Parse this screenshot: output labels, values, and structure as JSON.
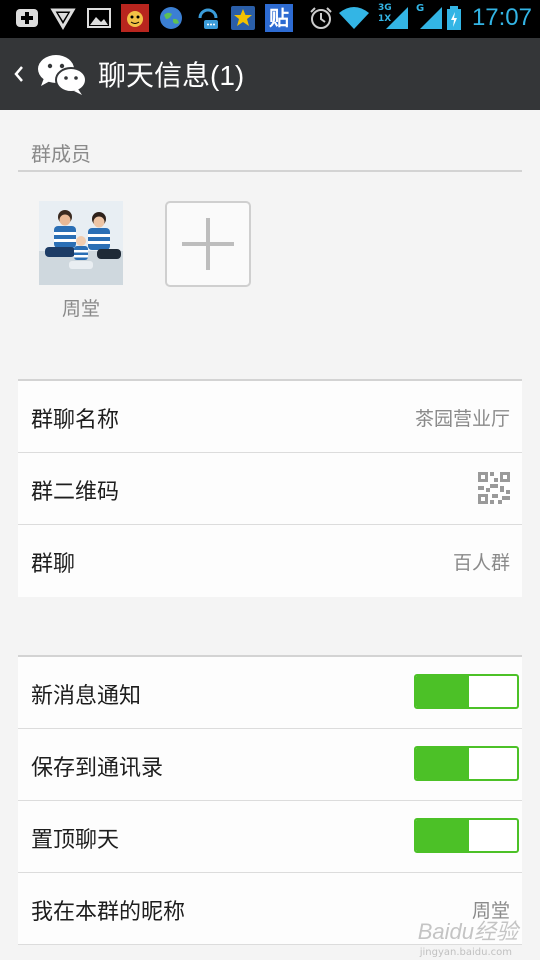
{
  "status_bar": {
    "time": "17:07",
    "network_3g": "3G",
    "network_1x": "1X",
    "network_g": "G",
    "app_icon_label": "贴",
    "icons": [
      "add-icon",
      "shield-icon",
      "image-icon",
      "mascot-icon",
      "globe-icon",
      "chat-icon",
      "star-icon",
      "tieba-icon",
      "alarm-icon",
      "wifi-icon",
      "signal-icon",
      "battery-icon"
    ]
  },
  "header": {
    "title": "聊天信息(1)"
  },
  "members_section": {
    "label": "群成员",
    "members": [
      {
        "name": "周堂"
      }
    ]
  },
  "info_rows": [
    {
      "label": "群聊名称",
      "value": "茶园营业厅"
    },
    {
      "label": "群二维码",
      "value": ""
    },
    {
      "label": "群聊",
      "value": "百人群"
    }
  ],
  "settings_rows": [
    {
      "label": "新消息通知",
      "toggle_on": true
    },
    {
      "label": "保存到通讯录",
      "toggle_on": true
    },
    {
      "label": "置顶聊天",
      "toggle_on": true
    },
    {
      "label": "我在本群的昵称",
      "value": "周堂"
    }
  ],
  "watermark": {
    "text": "Baidu经验",
    "sub": "jingyan.baidu.com"
  },
  "colors": {
    "title_bar": "#343638",
    "toggle_green": "#4cc127",
    "status_time": "#33b5e5"
  }
}
